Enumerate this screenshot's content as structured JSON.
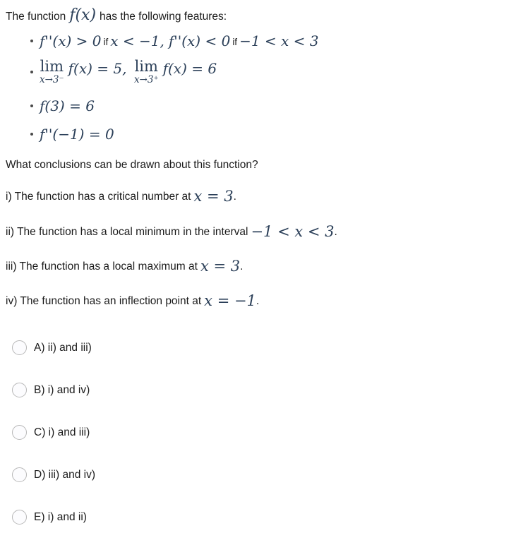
{
  "intro": {
    "before": "The function",
    "math": "f(x)",
    "after": "has the following features:"
  },
  "features": [
    {
      "id": "second-derivative-signs",
      "part1": "f''(x) > 0",
      "if1": "if",
      "part2": "x < −1,",
      "part3": "f''(x) < 0",
      "if2": "if",
      "part4": "−1 < x < 3"
    },
    {
      "id": "limits-at-three",
      "lim_op1": "lim",
      "lim_sub1": "x→3⁻",
      "lim_body1": "f(x) = 5,",
      "lim_op2": "lim",
      "lim_sub2": "x→3⁺",
      "lim_body2": "f(x) = 6"
    },
    {
      "id": "value-at-three",
      "text": "f(3) = 6"
    },
    {
      "id": "second-derivative-at-neg-one",
      "text": "f''(−1) = 0"
    }
  ],
  "question": "What conclusions can be drawn about this function?",
  "statements": [
    {
      "id": "statement-i",
      "text": "i) The function has a critical number at",
      "math": "x = 3",
      "period": "."
    },
    {
      "id": "statement-ii",
      "text": "ii) The function has a local minimum in the interval",
      "math": "−1 < x < 3",
      "period": "."
    },
    {
      "id": "statement-iii",
      "text": "iii) The function has a local maximum at",
      "math": "x = 3",
      "period": "."
    },
    {
      "id": "statement-iv",
      "text": "iv) The function has an inflection point at",
      "math": "x = −1",
      "period": "."
    }
  ],
  "options": [
    {
      "id": "option-a",
      "label": "A)  ii) and iii)",
      "selected": false
    },
    {
      "id": "option-b",
      "label": "B)  i) and iv)",
      "selected": false
    },
    {
      "id": "option-c",
      "label": "C)  i) and iii)",
      "selected": false
    },
    {
      "id": "option-d",
      "label": "D)  iii) and iv)",
      "selected": false
    },
    {
      "id": "option-e",
      "label": "E)  i) and ii)",
      "selected": false
    }
  ],
  "colors": {
    "background": "#ffffff",
    "body_text": "#1b1b1b",
    "math_text": "#2c4059",
    "radio_border": "#b8b8b8",
    "radio_fill": "#fcfcfe",
    "bullet": "#4a4a4a"
  }
}
